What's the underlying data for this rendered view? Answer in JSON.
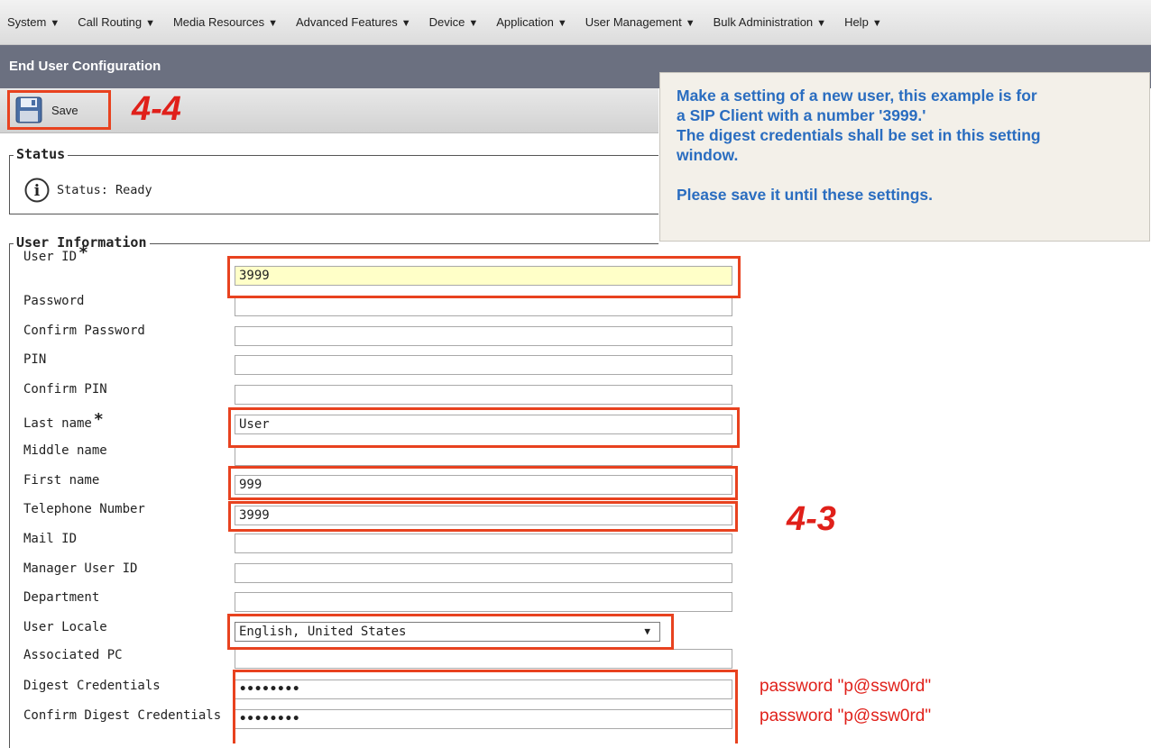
{
  "menu": [
    {
      "label": "System"
    },
    {
      "label": "Call Routing"
    },
    {
      "label": "Media Resources"
    },
    {
      "label": "Advanced Features"
    },
    {
      "label": "Device"
    },
    {
      "label": "Application"
    },
    {
      "label": "User Management"
    },
    {
      "label": "Bulk Administration"
    },
    {
      "label": "Help"
    }
  ],
  "page_title": "End User Configuration",
  "toolbar": {
    "save_label": "Save",
    "save_icon": "floppy-disk-icon"
  },
  "annotations": {
    "save_step": "4-4",
    "form_step": "4-3"
  },
  "note": {
    "line1": "Make a setting of a new user, this example is for",
    "line2": "a SIP Client with a number '3999.'",
    "line3": "The digest credentials shall be set in this setting",
    "line4": "window.",
    "line5": "Please save it until these settings."
  },
  "status": {
    "legend": "Status",
    "text": "Status: Ready",
    "icon": "info-icon"
  },
  "user_info": {
    "legend": "User Information",
    "fields": [
      {
        "label": "User ID",
        "value": "3999"
      },
      {
        "label": "Password",
        "value": ""
      },
      {
        "label": "Confirm Password",
        "value": ""
      },
      {
        "label": "PIN",
        "value": ""
      },
      {
        "label": "Confirm PIN",
        "value": ""
      },
      {
        "label": "Last name",
        "value": "User"
      },
      {
        "label": "Middle name",
        "value": ""
      },
      {
        "label": "First name",
        "value": "999"
      },
      {
        "label": "Telephone Number",
        "value": "3999"
      },
      {
        "label": "Mail ID",
        "value": ""
      },
      {
        "label": "Manager User ID",
        "value": ""
      },
      {
        "label": "Department",
        "value": ""
      },
      {
        "label": "User Locale",
        "value": "English, United States"
      },
      {
        "label": "Associated PC",
        "value": ""
      },
      {
        "label": "Digest Credentials",
        "value": "••••••••"
      },
      {
        "label": "Confirm Digest Credentials",
        "value": "••••••••"
      }
    ],
    "required_marker": "*"
  },
  "side_notes": {
    "digest": "password \"p@ssw0rd\"",
    "confirm_digest": "password \"p@ssw0rd\""
  },
  "colors": {
    "highlight": "#e8421f",
    "note_text": "#2a6dc0",
    "title_bar": "#6b7080"
  }
}
